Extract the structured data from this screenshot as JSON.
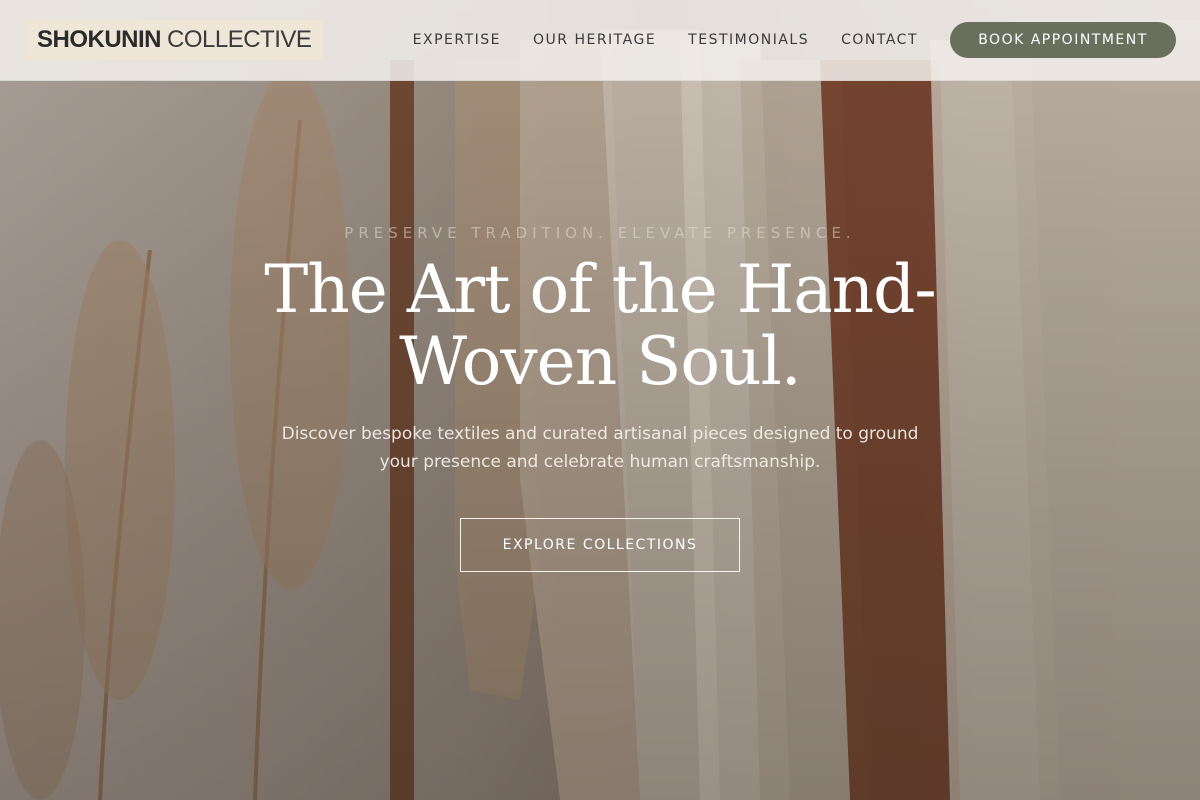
{
  "brand": {
    "name_bold": "SHOKUNIN",
    "name_light": "COLLECTIVE"
  },
  "nav": {
    "items": [
      {
        "label": "EXPERTISE"
      },
      {
        "label": "OUR HERITAGE"
      },
      {
        "label": "TESTIMONIALS"
      },
      {
        "label": "CONTACT"
      }
    ],
    "cta_label": "BOOK APPOINTMENT"
  },
  "hero": {
    "eyebrow": "PRESERVE TRADITION. ELEVATE PRESENCE.",
    "headline_line1": "The Art of the Hand-",
    "headline_line2": "Woven Soul.",
    "subtext_line1": "Discover bespoke textiles and curated artisanal pieces designed to ground",
    "subtext_line2": "your presence and celebrate human craftsmanship.",
    "cta_label": "EXPLORE COLLECTIONS"
  },
  "colors": {
    "accent": "#6a6e5d",
    "header_bg": "#f3f0ec",
    "logo_bg": "#eee6d6",
    "text_dark": "#2b2b2b"
  }
}
